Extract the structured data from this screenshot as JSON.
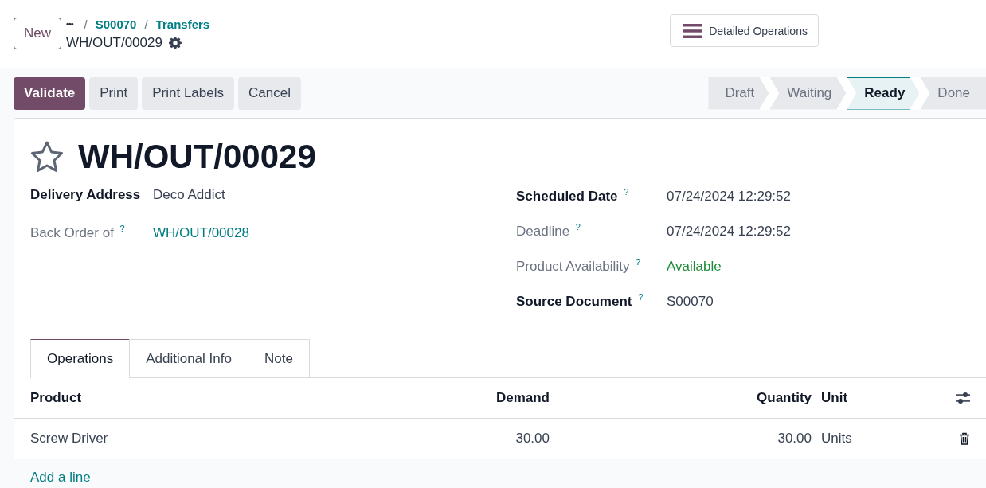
{
  "control_panel": {
    "new_button": "New",
    "breadcrumbs": [
      {
        "label": "•••",
        "kind": "menu"
      },
      {
        "label": "/",
        "kind": "separator"
      },
      {
        "label": "S00070",
        "kind": "link"
      },
      {
        "label": "/",
        "kind": "separator"
      },
      {
        "label": "Transfers",
        "kind": "link"
      }
    ],
    "record_name": "WH/OUT/00029",
    "detailed_operations": "Detailed Operations"
  },
  "actions": [
    {
      "label": "Validate",
      "primary": true
    },
    {
      "label": "Print",
      "primary": false
    },
    {
      "label": "Print Labels",
      "primary": false
    },
    {
      "label": "Cancel",
      "primary": false
    }
  ],
  "stages": [
    {
      "label": "Draft",
      "selected": false
    },
    {
      "label": "Waiting",
      "selected": false
    },
    {
      "label": "Ready",
      "selected": true
    },
    {
      "label": "Done",
      "selected": false
    }
  ],
  "sheet": {
    "starred": false,
    "title": "WH/OUT/00029",
    "left_fields": [
      {
        "label": "Delivery Address",
        "bold": true,
        "value": "Deco Addict",
        "kind": "text"
      },
      {
        "label": "Back Order of",
        "help": "?",
        "bold": false,
        "value": "WH/OUT/00028",
        "kind": "link"
      }
    ],
    "right_fields": [
      {
        "label": "Scheduled Date",
        "help": "?",
        "bold": true,
        "value": "07/24/2024 12:29:52",
        "kind": "text"
      },
      {
        "label": "Deadline",
        "help": "?",
        "bold": false,
        "value": "07/24/2024 12:29:52",
        "kind": "text"
      },
      {
        "label": "Product Availability",
        "help": "?",
        "bold": false,
        "value": "Available",
        "kind": "status"
      },
      {
        "label": "Source Document",
        "help": "?",
        "bold": true,
        "value": "S00070",
        "kind": "text"
      }
    ],
    "tabs": [
      {
        "label": "Operations",
        "selected": true
      },
      {
        "label": "Additional Info",
        "selected": false
      },
      {
        "label": "Note",
        "selected": false
      }
    ],
    "table": {
      "columns": [
        {
          "label": "Product",
          "kind": "text"
        },
        {
          "label": "Demand",
          "kind": "number"
        },
        {
          "label": "Quantity",
          "kind": "number"
        },
        {
          "label": "Unit",
          "kind": "text"
        }
      ],
      "rows": [
        {
          "cells": [
            "Screw Driver",
            "30.00",
            "30.00",
            "Units"
          ]
        }
      ],
      "add_line": "Add a line"
    }
  }
}
